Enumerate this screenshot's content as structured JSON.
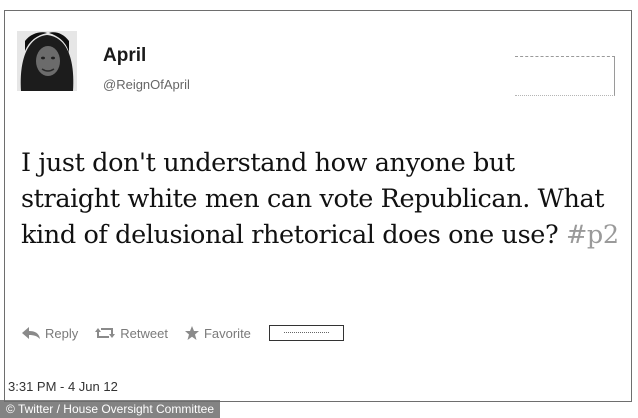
{
  "tweet": {
    "display_name": "April",
    "username": "@ReignOfApril",
    "text_main": "I just don't understand how anyone but straight white men can vote Republican. What kind of delusional rhetorical does one use?",
    "hashtag": "#p2",
    "timestamp": "3:31 PM - 4 Jun 12"
  },
  "actions": {
    "reply": "Reply",
    "retweet": "Retweet",
    "favorite": "Favorite"
  },
  "credit": "© Twitter / House Oversight Committee",
  "icons": {
    "avatar": "profile-photo",
    "reply": "reply-arrow-icon",
    "retweet": "retweet-icon",
    "favorite": "star-icon"
  }
}
